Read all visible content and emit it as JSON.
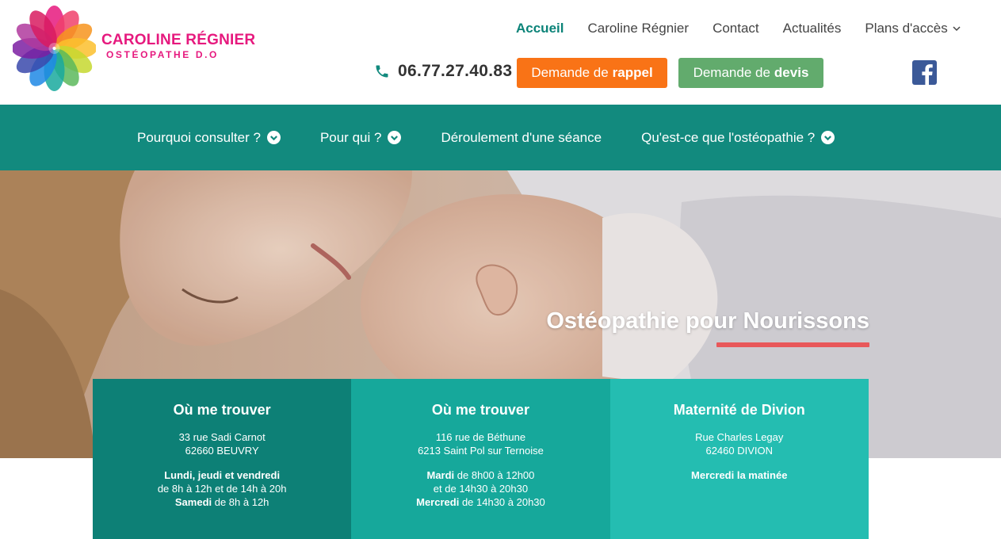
{
  "brand": {
    "name": "CAROLINE RÉGNIER",
    "subtitle": "OSTÉOPATHE D.O",
    "color": "#e6197e"
  },
  "top_nav": {
    "items": [
      {
        "label": "Accueil",
        "active": true
      },
      {
        "label": "Caroline Régnier"
      },
      {
        "label": "Contact"
      },
      {
        "label": "Actualités"
      },
      {
        "label": "Plans d'accès",
        "has_dropdown": true
      }
    ]
  },
  "contact": {
    "phone": "06.77.27.40.83",
    "callback_prefix": "Demande de",
    "callback_strong": "rappel",
    "quote_prefix": "Demande de",
    "quote_strong": "devis"
  },
  "social": {
    "icon": "facebook-icon",
    "label": "f"
  },
  "sub_nav": {
    "items": [
      {
        "label": "Pourquoi consulter ?",
        "has_dropdown": true
      },
      {
        "label": "Pour qui ?",
        "has_dropdown": true
      },
      {
        "label": "Déroulement d'une séance",
        "has_dropdown": false
      },
      {
        "label": "Qu'est-ce que l'ostéopathie ?",
        "has_dropdown": true
      }
    ]
  },
  "hero": {
    "title": "Ostéopathie pour Nourissons"
  },
  "locations": [
    {
      "title": "Où me trouver",
      "address_line1": "33 rue Sadi Carnot",
      "address_line2": "62660 BEUVRY",
      "hours": [
        {
          "strong": "Lundi, jeudi et vendredi",
          "text": ""
        },
        {
          "strong": "",
          "text": "de 8h à 12h et de 14h à 20h"
        },
        {
          "strong": "Samedi",
          "text": " de 8h à 12h"
        }
      ]
    },
    {
      "title": "Où me trouver",
      "address_line1": "116 rue de Béthune",
      "address_line2": "6213 Saint Pol sur Ternoise",
      "hours": [
        {
          "strong": "Mardi",
          "text": " de 8h00 à 12h00"
        },
        {
          "strong": "",
          "text": "et de 14h30 à 20h30"
        },
        {
          "strong": "Mercredi",
          "text": " de 14h30 à 20h30"
        }
      ]
    },
    {
      "title": "Maternité de Divion",
      "address_line1": "Rue Charles Legay",
      "address_line2": "62460 DIVION",
      "hours": [
        {
          "strong": "Mercredi la matinée",
          "text": ""
        }
      ]
    }
  ],
  "colors": {
    "teal_dark": "#0d8076",
    "teal_mid": "#16a89b",
    "teal_light": "#24bdb1",
    "nav_bg": "#128a7e",
    "orange": "#f97316",
    "green": "#62ab6d",
    "accent_underline": "#e8585a"
  }
}
